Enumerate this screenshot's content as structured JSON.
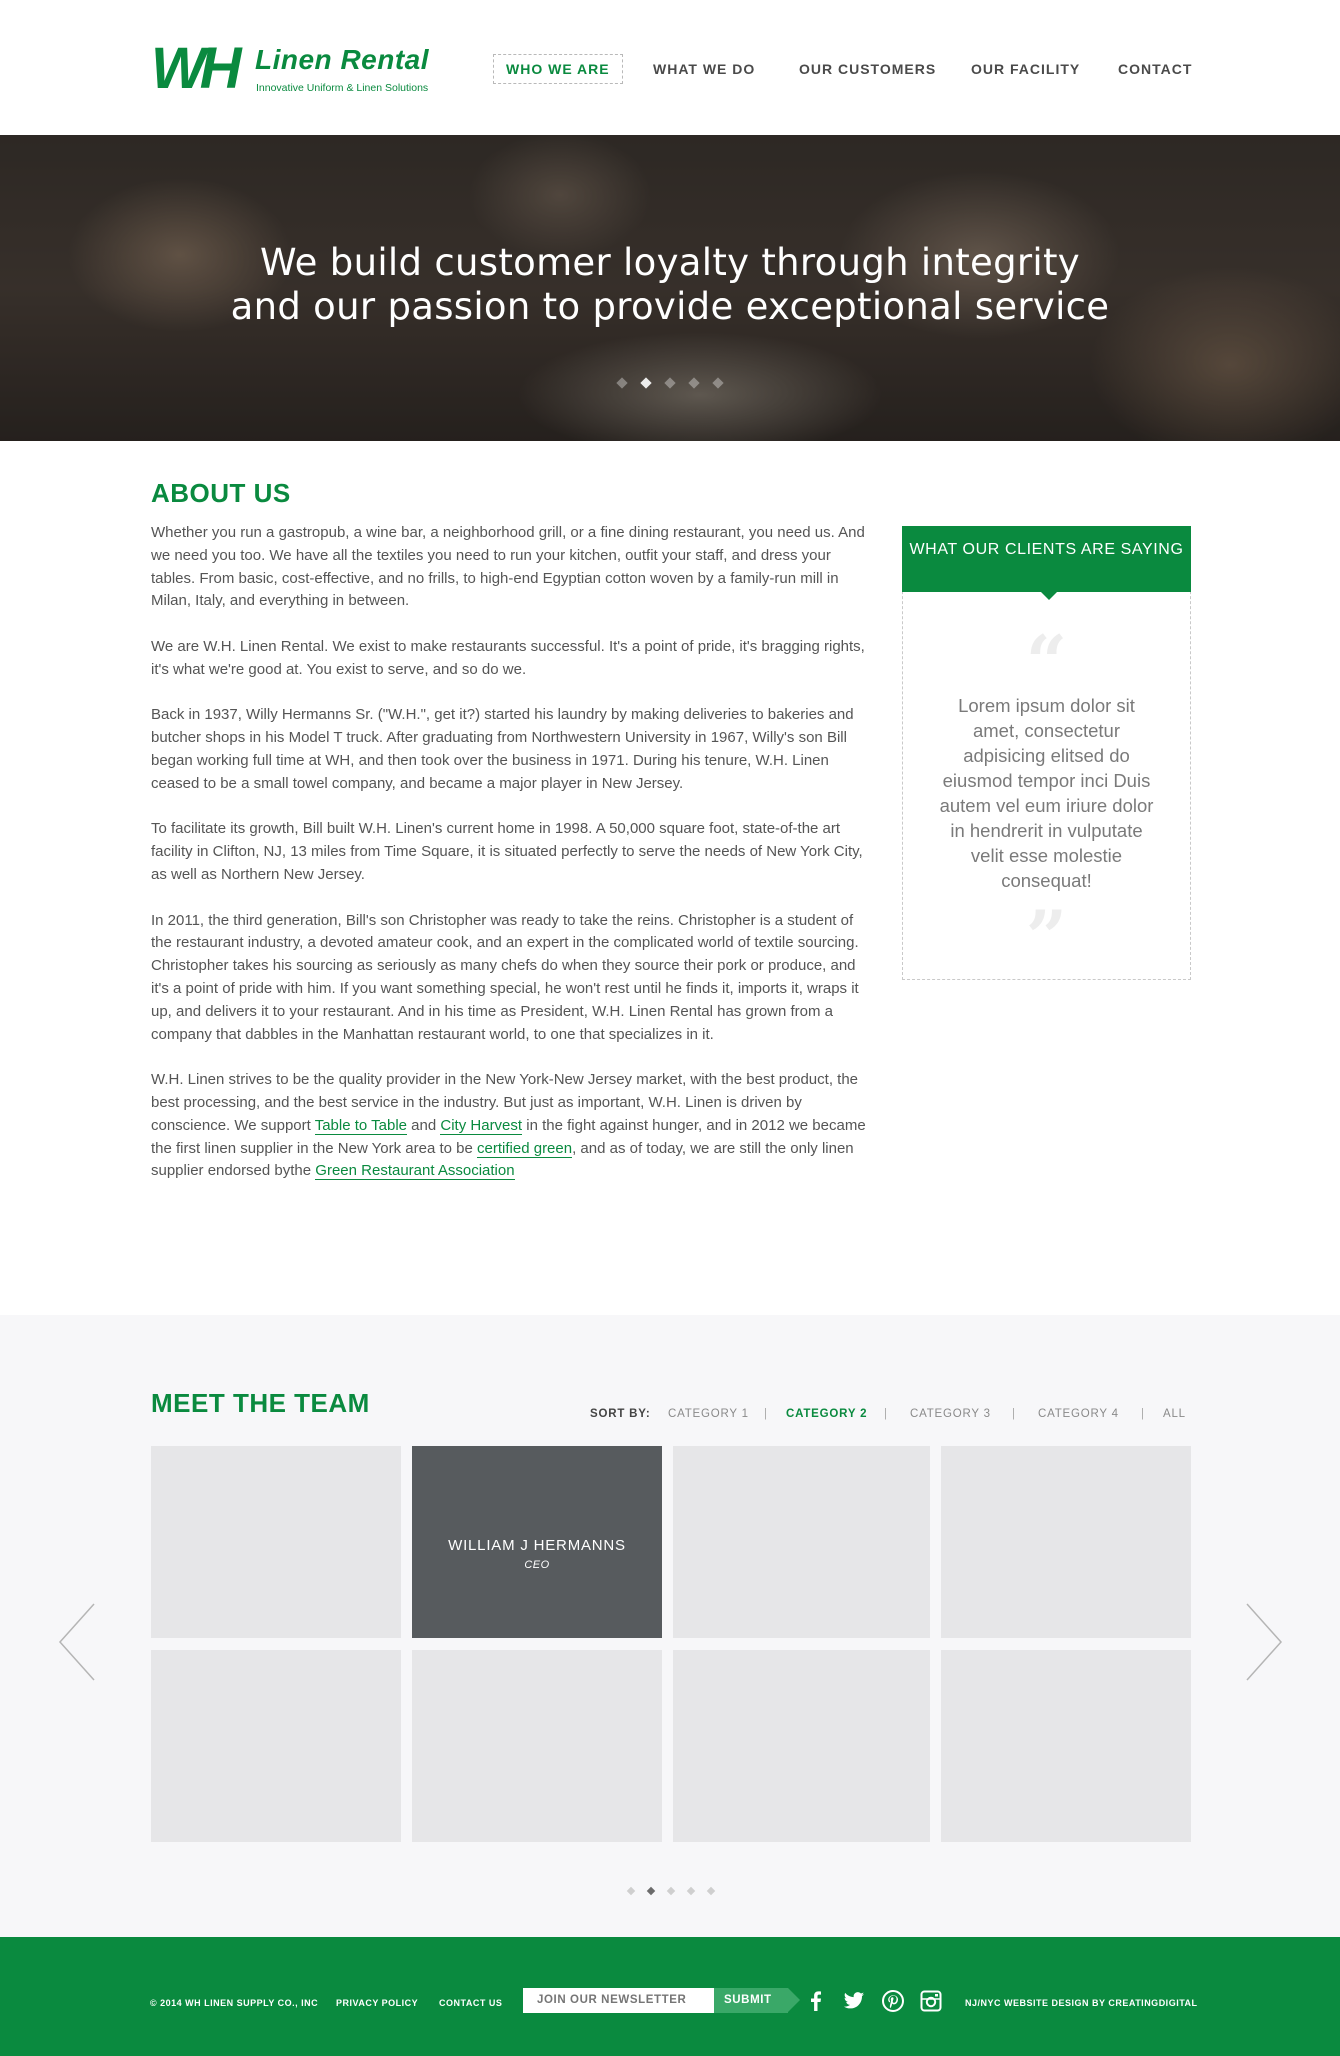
{
  "brand": {
    "logo_mark": "WH",
    "name": "Linen Rental",
    "tagline": "Innovative Uniform & Linen Solutions",
    "accent_color": "#0a8a3f"
  },
  "nav": {
    "items": [
      {
        "label": "WHO WE ARE",
        "active": true
      },
      {
        "label": "WHAT WE DO"
      },
      {
        "label": "OUR CUSTOMERS"
      },
      {
        "label": "OUR FACILITY"
      },
      {
        "label": "CONTACT"
      }
    ]
  },
  "hero": {
    "line1": "We build customer loyalty through integrity",
    "line2": "and our passion to provide exceptional service",
    "slide_count": 5,
    "active_slide": 2
  },
  "about": {
    "title": "ABOUT US",
    "p1": "Whether you run a gastropub, a wine bar, a neighborhood grill, or a fine dining restaurant, you need us. And we need you too. We have all the textiles you need to run your kitchen, outfit your staff, and dress your tables. From basic, cost-effective, and no frills, to high-end Egyptian cotton woven by a family-run mill in Milan, Italy, and everything in between.",
    "p2": "We are W.H. Linen Rental. We exist to make restaurants successful. It's a point of pride, it's bragging rights, it's what we're good at. You exist to serve, and so do we.",
    "p3": "Back in 1937, Willy Hermanns Sr. (\"W.H.\", get it?) started his laundry by making deliveries to bakeries and butcher shops in his Model T truck. After graduating from Northwestern University in 1967, Willy's son Bill began working full time at WH, and then took over the business in 1971. During his tenure, W.H. Linen ceased to be a small towel company, and became a major player in New Jersey.",
    "p4": "To facilitate its growth, Bill built W.H. Linen's current home in 1998. A 50,000 square foot, state-of-the art facility in Clifton, NJ, 13 miles from Time Square, it is situated perfectly to serve the needs of New York City, as well as Northern New Jersey.",
    "p5": "In 2011, the third generation, Bill's son Christopher was ready to take the reins. Christopher is a student of the restaurant industry, a devoted amateur cook, and an expert in the complicated world of textile sourcing. Christopher takes his sourcing as seriously as many chefs do when they source their pork or produce, and it's a point of pride with him. If you want something special, he won't rest until he finds it, imports it, wraps it up, and delivers it to your restaurant. And in his time as President, W.H. Linen Rental has grown from a company that dabbles in the Manhattan restaurant world, to one that specializes in it.",
    "p6": {
      "t1": "W.H. Linen strives to be the quality provider in the New York-New Jersey market, with the best product, the best processing, and the best service in the industry. But just as important, W.H. Linen is driven by conscience. We support ",
      "link1": "Table to Table",
      "t2": " and ",
      "link2": "City Harvest",
      "t3": " in the fight against hunger, and in 2012 we became the first linen supplier in the New York area to be ",
      "link3": "certified green",
      "t4": ", and as of today, we are still the only linen supplier endorsed bythe ",
      "link4": "Green Restaurant Association"
    }
  },
  "testimonial": {
    "heading": "WHAT OUR CLIENTS ARE SAYING",
    "quote": "Lorem ipsum dolor sit amet, consectetur adpisicing elitsed do eiusmod tempor inci Duis autem vel eum iriure dolor in hendrerit in vulputate velit esse molestie consequat!",
    "open_mark": "“",
    "close_mark": "”"
  },
  "team": {
    "title": "MEET THE TEAM",
    "sort_label": "SORT BY:",
    "categories": [
      {
        "label": "CATEGORY 1"
      },
      {
        "label": "CATEGORY 2",
        "active": true
      },
      {
        "label": "CATEGORY 3"
      },
      {
        "label": "CATEGORY 4"
      },
      {
        "label": "ALL"
      }
    ],
    "separator": "|",
    "featured": {
      "name": "WILLIAM J HERMANNS",
      "role": "CEO"
    },
    "page_count": 5,
    "active_page": 2
  },
  "footer": {
    "copyright": "© 2014 WH LINEN SUPPLY CO., INC",
    "privacy": "PRIVACY POLICY",
    "contact": "CONTACT US",
    "newsletter_placeholder": "JOIN OUR NEWSLETTER",
    "submit": "SUBMIT",
    "social": [
      "facebook-icon",
      "twitter-icon",
      "pinterest-icon",
      "instagram-icon"
    ],
    "credit": "NJ/NYC WEBSITE DESIGN BY CREATINGDIGITAL"
  }
}
